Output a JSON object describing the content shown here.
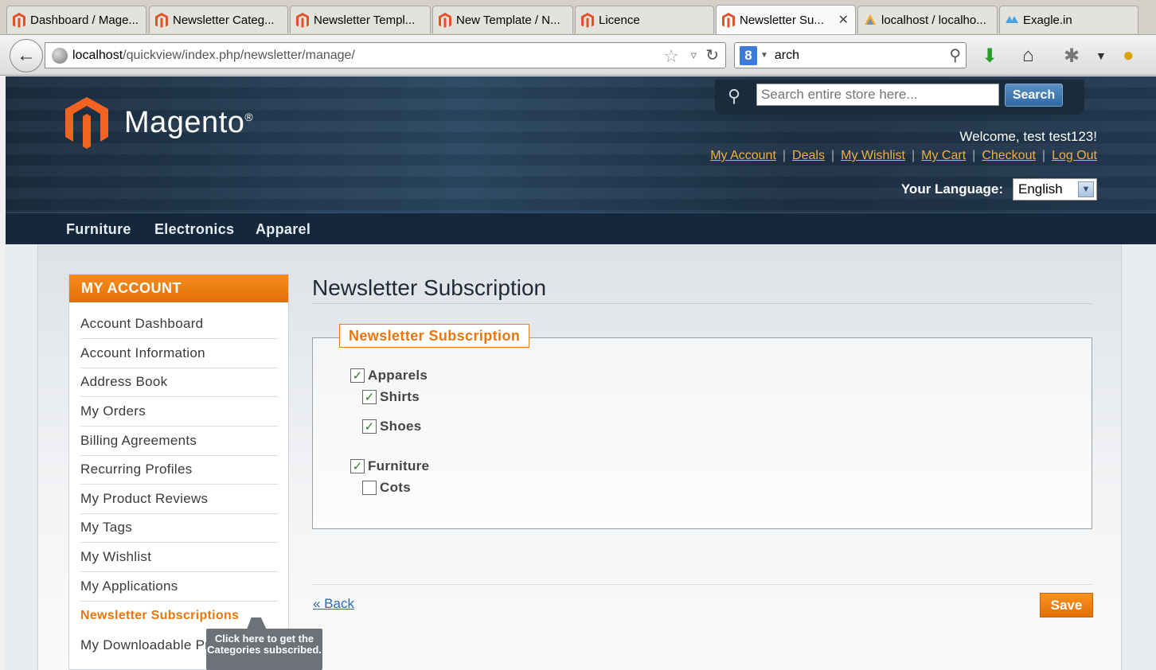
{
  "browser": {
    "tabs": [
      {
        "label": "Dashboard / Mage...",
        "icon": "magento-icon"
      },
      {
        "label": "Newsletter Categ...",
        "icon": "magento-icon"
      },
      {
        "label": "Newsletter Templ...",
        "icon": "magento-icon"
      },
      {
        "label": "New Template / N...",
        "icon": "magento-icon"
      },
      {
        "label": "Licence",
        "icon": "magento-icon"
      },
      {
        "label": "Newsletter Su...",
        "icon": "magento-icon",
        "active": true
      },
      {
        "label": "localhost / localho...",
        "icon": "phpmyadmin-icon"
      },
      {
        "label": "Exagle.in",
        "icon": "exagle-icon"
      }
    ],
    "close_glyph": "✕",
    "url_host": "localhost",
    "url_path": "/quickview/index.php/newsletter/manage/",
    "search_query": "arch"
  },
  "store": {
    "logo_text": "Magento",
    "logo_reg": "®",
    "search_placeholder": "Search entire store here...",
    "search_button": "Search",
    "welcome": "Welcome, test test123!",
    "links": [
      "My Account",
      "Deals",
      "My Wishlist",
      "My Cart",
      "Checkout",
      "Log Out"
    ],
    "language_label": "Your Language:",
    "language_value": "English",
    "nav": [
      "Furniture",
      "Electronics",
      "Apparel"
    ]
  },
  "sidebar": {
    "title": "MY ACCOUNT",
    "items": [
      "Account Dashboard",
      "Account Information",
      "Address Book",
      "My Orders",
      "Billing Agreements",
      "Recurring Profiles",
      "My Product Reviews",
      "My Tags",
      "My Wishlist",
      "My Applications",
      "Newsletter Subscriptions",
      "My Downloadable Products"
    ],
    "active_index": 10,
    "tooltip": "Click here to get the Categories subscribed."
  },
  "main": {
    "title": "Newsletter Subscription",
    "legend": "Newsletter Subscription",
    "categories": [
      {
        "label": "Apparels",
        "checked": true,
        "level": 0
      },
      {
        "label": "Shirts",
        "checked": true,
        "level": 1
      },
      {
        "label": "Shoes",
        "checked": true,
        "level": 1
      },
      {
        "label": "Furniture",
        "checked": true,
        "level": 0
      },
      {
        "label": "Cots",
        "checked": false,
        "level": 1
      }
    ],
    "back_label": "« Back",
    "save_label": "Save"
  },
  "colors": {
    "accent_orange": "#e8760e",
    "header_blue": "#1b2c3e",
    "link_yellow": "#f0b040"
  }
}
